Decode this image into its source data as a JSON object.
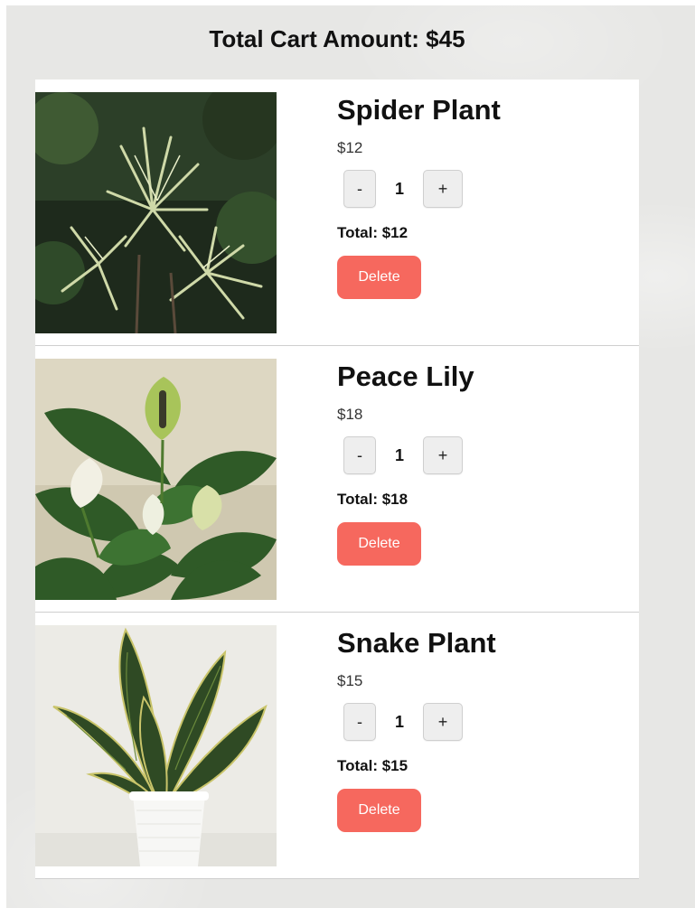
{
  "cart": {
    "total_label": "Total Cart Amount: $45"
  },
  "items": [
    {
      "name": "Spider Plant",
      "price": "$12",
      "quantity": "1",
      "total": "Total: $12",
      "decrement": "-",
      "increment": "+",
      "delete_label": "Delete"
    },
    {
      "name": "Peace Lily",
      "price": "$18",
      "quantity": "1",
      "total": "Total: $18",
      "decrement": "-",
      "increment": "+",
      "delete_label": "Delete"
    },
    {
      "name": "Snake Plant",
      "price": "$15",
      "quantity": "1",
      "total": "Total: $15",
      "decrement": "-",
      "increment": "+",
      "delete_label": "Delete"
    }
  ],
  "colors": {
    "delete_button": "#f6685e",
    "page_background": "#e7e7e5",
    "card_background": "#ffffff"
  }
}
